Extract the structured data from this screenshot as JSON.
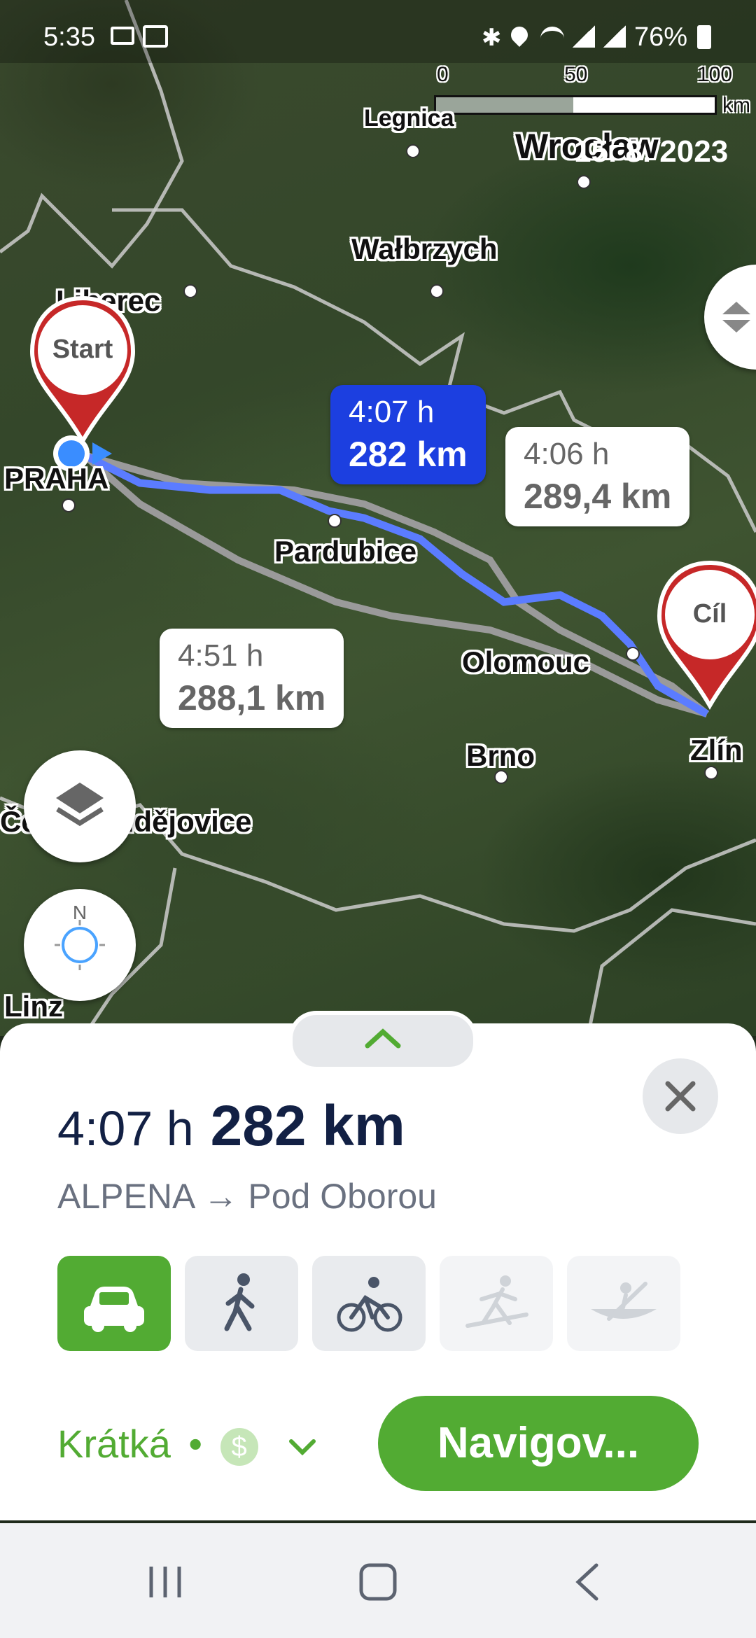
{
  "status_bar": {
    "time": "5:35",
    "battery": "76%",
    "icons": [
      "gmail-icon",
      "gallery-icon",
      "bluetooth-icon",
      "location-icon",
      "wifi-icon",
      "signal-icon",
      "signal-icon",
      "battery-icon"
    ]
  },
  "map": {
    "scale": {
      "labels": [
        "0",
        "50",
        "100"
      ],
      "unit": "km"
    },
    "date_overlay": "15. 8. 2023",
    "cities": [
      "Legnica",
      "Wrocław",
      "Wałbrzych",
      "Liberec",
      "PRAHA",
      "Pardubice",
      "Olomouc",
      "Brno",
      "Zlín",
      "České Budějovice",
      "Linz"
    ],
    "markers": {
      "start_label": "Start",
      "end_label": "Cíl"
    },
    "routes": [
      {
        "time": "4:07 h",
        "distance": "282 km",
        "selected": true
      },
      {
        "time": "4:06 h",
        "distance": "289,4 km",
        "selected": false
      },
      {
        "time": "4:51 h",
        "distance": "288,1 km",
        "selected": false
      }
    ],
    "compass_label": "N"
  },
  "sheet": {
    "time": "4:07 h",
    "distance": "282 km",
    "route_name": "ALPENA → Pod Oborou",
    "modes": [
      {
        "icon": "car-icon",
        "active": true
      },
      {
        "icon": "walking-icon",
        "active": false
      },
      {
        "icon": "cycling-icon",
        "active": false
      },
      {
        "icon": "ski-icon",
        "active": false,
        "disabled": true
      },
      {
        "icon": "canoe-icon",
        "active": false,
        "disabled": true
      }
    ],
    "preference": "Krátká",
    "preference_separator": "•",
    "toll_icon": "dollar-icon",
    "navigate_label": "Navigov..."
  },
  "colors": {
    "accent_green": "#52ab33",
    "route_blue": "#1c3fe0",
    "marker_red": "#c62828"
  }
}
